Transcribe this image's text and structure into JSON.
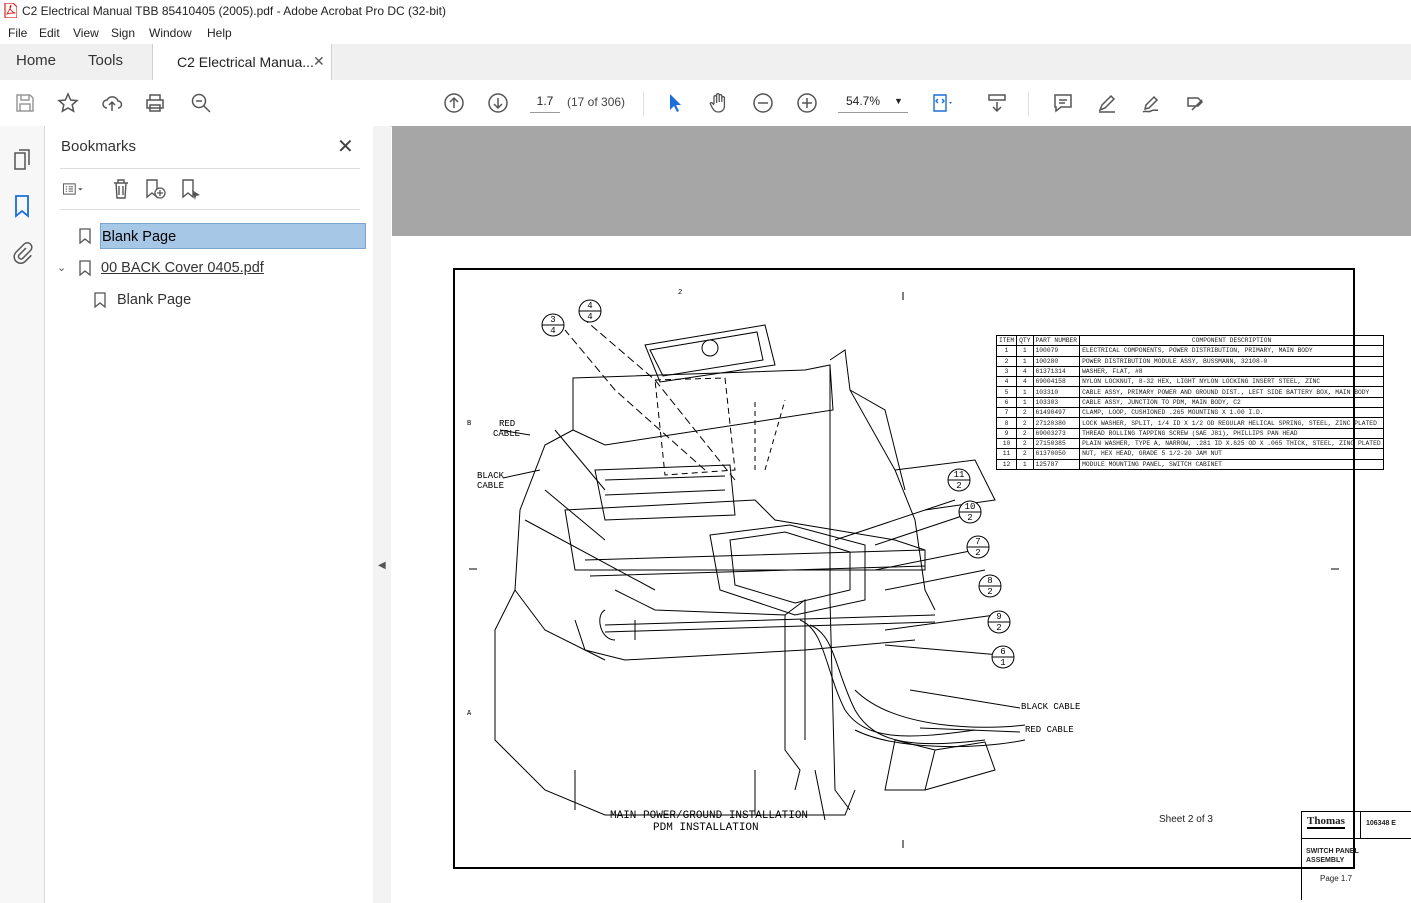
{
  "window": {
    "title": "C2 Electrical Manual TBB 85410405 (2005).pdf - Adobe Acrobat Pro DC (32-bit)"
  },
  "menu": [
    "File",
    "Edit",
    "View",
    "Sign",
    "Window",
    "Help"
  ],
  "tabs": {
    "home": "Home",
    "tools": "Tools",
    "doc": "C2 Electrical Manua..."
  },
  "toolbar": {
    "page_input": "1.7",
    "page_count": "(17 of 306)",
    "zoom": "54.7%"
  },
  "bookmarks": {
    "title": "Bookmarks",
    "items": [
      {
        "label": "Blank Page",
        "level": 0,
        "selected": true
      },
      {
        "label": "00 BACK Cover 0405.pdf",
        "level": 0,
        "expanded": true
      },
      {
        "label": "Blank Page",
        "level": 1
      }
    ]
  },
  "drawing": {
    "parts_header": [
      "ITEM",
      "QTY",
      "PART NUMBER",
      "COMPONENT DESCRIPTION"
    ],
    "parts": [
      [
        "1",
        "1",
        "100079",
        "ELECTRICAL COMPONENTS, POWER DISTRIBUTION, PRIMARY, MAIN BODY"
      ],
      [
        "2",
        "1",
        "100280",
        "POWER DISTRIBUTION MODULE ASSY, BUSSMANN, 32108-0"
      ],
      [
        "3",
        "4",
        "61371314",
        "WASHER, FLAT, #8"
      ],
      [
        "4",
        "4",
        "69004158",
        "NYLON LOCKNUT, 8-32 HEX, LIGHT NYLON LOCKING INSERT STEEL, ZINC"
      ],
      [
        "5",
        "1",
        "103310",
        "CABLE ASSY, PRIMARY POWER AND GROUND DIST., LEFT SIDE BATTERY BOX, MAIN BODY"
      ],
      [
        "6",
        "1",
        "103303",
        "CABLE ASSY, JUNCTION TO PDM, MAIN BODY, C2"
      ],
      [
        "7",
        "2",
        "61490497",
        "CLAMP, LOOP, CUSHIONED .265 MOUNTING X 1.00 I.D."
      ],
      [
        "8",
        "2",
        "27120380",
        "LOCK WASHER, SPLIT, 1/4 ID X 1/2 OD REGULAR HELICAL SPRING, STEEL, ZINC PLATED"
      ],
      [
        "9",
        "2",
        "69003273",
        "THREAD ROLLING TAPPING SCREW (SAE J81), PHILLIPS PAN HEAD"
      ],
      [
        "10",
        "2",
        "27150385",
        "PLAIN WASHER, TYPE A, NARROW, .281 ID X.625 OD X .065 THICK, STEEL, ZINC PLATED"
      ],
      [
        "11",
        "2",
        "61370050",
        "NUT, HEX HEAD, GRADE 5 1/2-20 JAM NUT"
      ],
      [
        "12",
        "1",
        "125787",
        "MODULE MOUNTING PANEL, SWITCH CABINET"
      ]
    ],
    "labels": {
      "red_cable_1": "RED",
      "red_cable_2": "CABLE",
      "black_cable_1": "BLACK",
      "black_cable_2": "CABLE",
      "black_cable_r": "BLACK CABLE",
      "red_cable_r": "RED CABLE",
      "caption_1": "MAIN POWER/GROUND INSTALLATION",
      "caption_2": "PDM INSTALLATION",
      "sheet": "Sheet 2 of 3",
      "logo": "Thomas",
      "drawing_no": "106348 E",
      "tb_title_1": "SWITCH PANEL",
      "tb_title_2": "ASSEMBLY",
      "page_label": "Page 1.7",
      "zone_2": "2",
      "zone_b": "B",
      "zone_a": "A"
    },
    "balloons": [
      {
        "top": "4",
        "bot": "4"
      },
      {
        "top": "3",
        "bot": "4"
      },
      {
        "top": "11",
        "bot": "2"
      },
      {
        "top": "10",
        "bot": "2"
      },
      {
        "top": "7",
        "bot": "2"
      },
      {
        "top": "8",
        "bot": "2"
      },
      {
        "top": "9",
        "bot": "2"
      },
      {
        "top": "6",
        "bot": "1"
      }
    ]
  }
}
